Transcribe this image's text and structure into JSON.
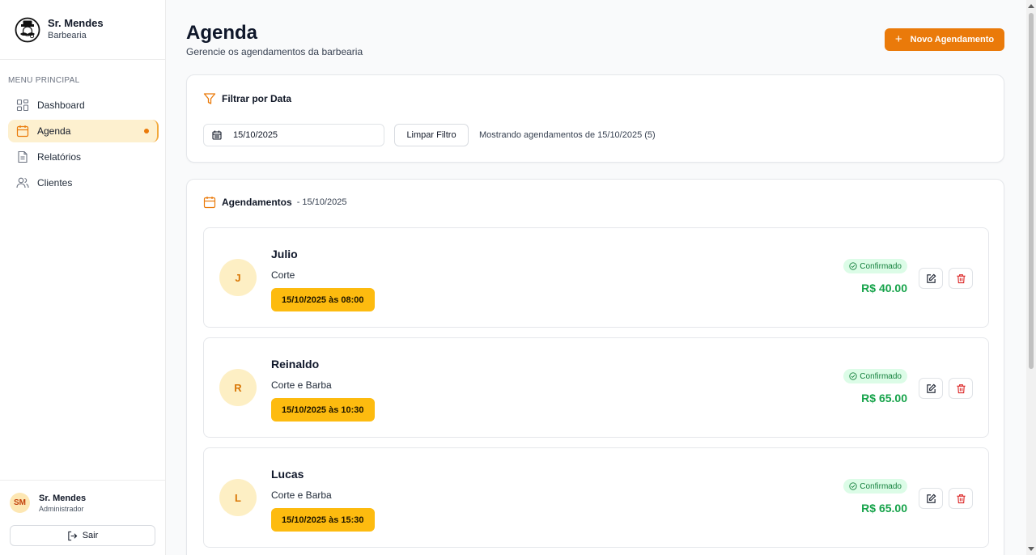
{
  "brand": {
    "name": "Sr. Mendes",
    "subtitle": "Barbearia",
    "icon": "barber-mustache-logo"
  },
  "sidebar": {
    "menu_title": "MENU PRINCIPAL",
    "items": [
      {
        "label": "Dashboard",
        "icon": "grid-icon",
        "active": false
      },
      {
        "label": "Agenda",
        "icon": "calendar-icon",
        "active": true
      },
      {
        "label": "Relatórios",
        "icon": "document-icon",
        "active": false
      },
      {
        "label": "Clientes",
        "icon": "users-icon",
        "active": false
      }
    ],
    "user": {
      "initials": "SM",
      "name": "Sr. Mendes",
      "role": "Administrador"
    },
    "logout_label": "Sair"
  },
  "header": {
    "title": "Agenda",
    "subtitle": "Gerencie os agendamentos da barbearia",
    "new_button_label": "Novo Agendamento"
  },
  "filter": {
    "title": "Filtrar por Data",
    "date_value": "15/10/2025",
    "clear_label": "Limpar Filtro",
    "status_text": "Mostrando agendamentos de 15/10/2025 (5)"
  },
  "appointments_section": {
    "title": "Agendamentos",
    "date_suffix": "- 15/10/2025",
    "items": [
      {
        "initial": "J",
        "name": "Julio",
        "service": "Corte",
        "datetime": "15/10/2025 às 08:00",
        "status": "Confirmado",
        "price": "R$ 40.00"
      },
      {
        "initial": "R",
        "name": "Reinaldo",
        "service": "Corte e Barba",
        "datetime": "15/10/2025 às 10:30",
        "status": "Confirmado",
        "price": "R$ 65.00"
      },
      {
        "initial": "L",
        "name": "Lucas",
        "service": "Corte e Barba",
        "datetime": "15/10/2025 às 15:30",
        "status": "Confirmado",
        "price": "R$ 65.00"
      }
    ]
  },
  "colors": {
    "accent": "#ea7a0a",
    "time_badge": "#fdbb0f",
    "price": "#16a34a",
    "status_bg": "#dcfce7",
    "delete": "#dc2626"
  }
}
